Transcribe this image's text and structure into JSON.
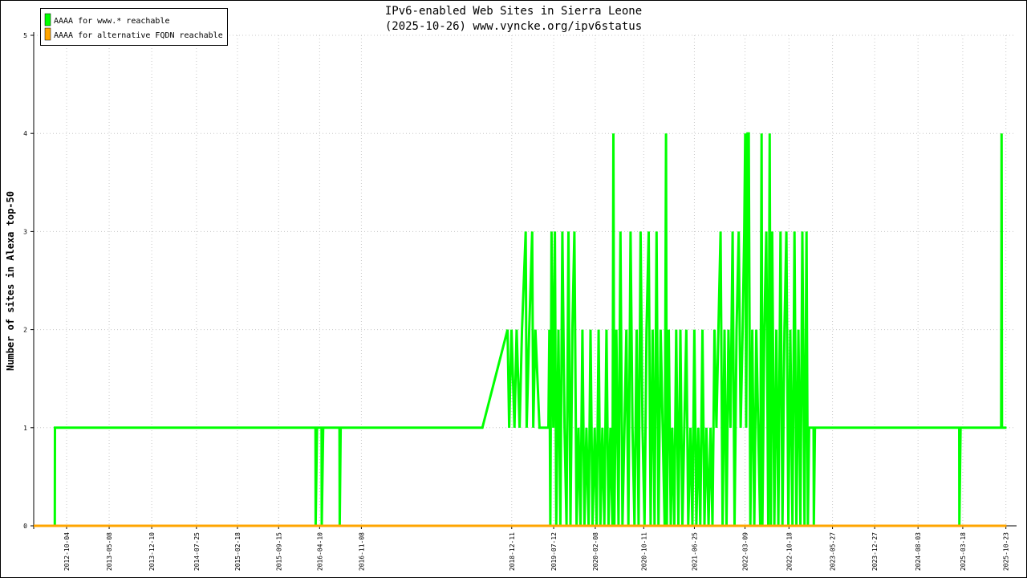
{
  "chart_data": {
    "type": "line",
    "title": "IPv6-enabled Web Sites in Sierra Leone",
    "subtitle": "(2025-10-26) www.vyncke.org/ipv6status",
    "ylabel": "Number of sites in Alexa top-50",
    "xlabel": "",
    "ylim": [
      0,
      5
    ],
    "yticks": [
      "0",
      "1",
      "2",
      "3",
      "4",
      "5"
    ],
    "xlim": [
      "2012-04-20",
      "2025-12-08"
    ],
    "xticks": [
      "2012-10-04",
      "2013-05-08",
      "2013-12-10",
      "2014-07-25",
      "2015-02-18",
      "2015-09-15",
      "2016-04-10",
      "2016-11-08",
      "2018-12-11",
      "2019-07-12",
      "2020-02-08",
      "2020-10-11",
      "2021-06-25",
      "2022-03-09",
      "2022-10-18",
      "2023-05-27",
      "2023-12-27",
      "2024-08-03",
      "2025-03-18",
      "2025-10-23"
    ],
    "grid": true,
    "legend_position": "top-left",
    "series": [
      {
        "name": "AAAA for www.* reachable",
        "color": "#00ff00",
        "points": [
          [
            "2012-04-20",
            0
          ],
          [
            "2012-08-05",
            0
          ],
          [
            "2012-08-06",
            1
          ],
          [
            "2016-03-20",
            1
          ],
          [
            "2016-03-21",
            0
          ],
          [
            "2016-03-28",
            1
          ],
          [
            "2016-04-20",
            1
          ],
          [
            "2016-04-21",
            0
          ],
          [
            "2016-04-28",
            1
          ],
          [
            "2016-07-20",
            1
          ],
          [
            "2016-07-21",
            0
          ],
          [
            "2016-07-26",
            1
          ],
          [
            "2018-07-15",
            1
          ],
          [
            "2018-11-20",
            2
          ],
          [
            "2018-11-28",
            1
          ],
          [
            "2018-12-10",
            2
          ],
          [
            "2018-12-25",
            1
          ],
          [
            "2019-01-05",
            2
          ],
          [
            "2019-01-20",
            1
          ],
          [
            "2019-02-01",
            2
          ],
          [
            "2019-02-20",
            3
          ],
          [
            "2019-02-25",
            1
          ],
          [
            "2019-03-10",
            2
          ],
          [
            "2019-03-25",
            3
          ],
          [
            "2019-03-30",
            1
          ],
          [
            "2019-04-10",
            2
          ],
          [
            "2019-05-01",
            1
          ],
          [
            "2019-06-15",
            1
          ],
          [
            "2019-06-20",
            2
          ],
          [
            "2019-06-25",
            0
          ],
          [
            "2019-07-01",
            3
          ],
          [
            "2019-07-10",
            1
          ],
          [
            "2019-07-18",
            3
          ],
          [
            "2019-07-25",
            0
          ],
          [
            "2019-08-05",
            2
          ],
          [
            "2019-08-15",
            0
          ],
          [
            "2019-08-25",
            3
          ],
          [
            "2019-09-05",
            1
          ],
          [
            "2019-09-15",
            0
          ],
          [
            "2019-09-25",
            3
          ],
          [
            "2019-10-05",
            0
          ],
          [
            "2019-10-15",
            2
          ],
          [
            "2019-10-25",
            3
          ],
          [
            "2019-11-05",
            0
          ],
          [
            "2019-11-15",
            1
          ],
          [
            "2019-11-25",
            0
          ],
          [
            "2019-12-05",
            2
          ],
          [
            "2019-12-15",
            0
          ],
          [
            "2019-12-25",
            1
          ],
          [
            "2020-01-05",
            0
          ],
          [
            "2020-01-15",
            2
          ],
          [
            "2020-01-25",
            0
          ],
          [
            "2020-02-05",
            1
          ],
          [
            "2020-02-15",
            0
          ],
          [
            "2020-02-25",
            2
          ],
          [
            "2020-03-05",
            0
          ],
          [
            "2020-03-15",
            1
          ],
          [
            "2020-03-25",
            0
          ],
          [
            "2020-04-05",
            2
          ],
          [
            "2020-04-15",
            0
          ],
          [
            "2020-04-25",
            1
          ],
          [
            "2020-05-05",
            0
          ],
          [
            "2020-05-10",
            4
          ],
          [
            "2020-05-15",
            0
          ],
          [
            "2020-05-25",
            2
          ],
          [
            "2020-06-05",
            0
          ],
          [
            "2020-06-15",
            3
          ],
          [
            "2020-06-25",
            0
          ],
          [
            "2020-07-05",
            1
          ],
          [
            "2020-07-15",
            2
          ],
          [
            "2020-07-25",
            0
          ],
          [
            "2020-08-05",
            3
          ],
          [
            "2020-08-15",
            1
          ],
          [
            "2020-08-25",
            0
          ],
          [
            "2020-09-05",
            2
          ],
          [
            "2020-09-15",
            0
          ],
          [
            "2020-09-25",
            3
          ],
          [
            "2020-10-05",
            1
          ],
          [
            "2020-10-15",
            0
          ],
          [
            "2020-10-25",
            2
          ],
          [
            "2020-11-05",
            3
          ],
          [
            "2020-11-15",
            0
          ],
          [
            "2020-11-25",
            2
          ],
          [
            "2020-12-05",
            0
          ],
          [
            "2020-12-15",
            3
          ],
          [
            "2020-12-25",
            0
          ],
          [
            "2021-01-05",
            2
          ],
          [
            "2021-01-15",
            1
          ],
          [
            "2021-01-25",
            0
          ],
          [
            "2021-02-01",
            4
          ],
          [
            "2021-02-05",
            0
          ],
          [
            "2021-02-15",
            2
          ],
          [
            "2021-02-25",
            0
          ],
          [
            "2021-03-05",
            1
          ],
          [
            "2021-03-15",
            0
          ],
          [
            "2021-03-25",
            2
          ],
          [
            "2021-04-05",
            0
          ],
          [
            "2021-04-15",
            2
          ],
          [
            "2021-04-25",
            0
          ],
          [
            "2021-05-05",
            1
          ],
          [
            "2021-05-15",
            2
          ],
          [
            "2021-05-25",
            0
          ],
          [
            "2021-06-05",
            1
          ],
          [
            "2021-06-15",
            0
          ],
          [
            "2021-06-25",
            2
          ],
          [
            "2021-07-05",
            0
          ],
          [
            "2021-07-15",
            1
          ],
          [
            "2021-07-25",
            0
          ],
          [
            "2021-08-05",
            2
          ],
          [
            "2021-08-15",
            0
          ],
          [
            "2021-08-25",
            1
          ],
          [
            "2021-09-05",
            0
          ],
          [
            "2021-09-15",
            1
          ],
          [
            "2021-09-25",
            0
          ],
          [
            "2021-10-05",
            2
          ],
          [
            "2021-10-15",
            1
          ],
          [
            "2021-10-25",
            2
          ],
          [
            "2021-11-05",
            3
          ],
          [
            "2021-11-15",
            0
          ],
          [
            "2021-11-25",
            2
          ],
          [
            "2021-12-05",
            0
          ],
          [
            "2021-12-15",
            2
          ],
          [
            "2021-12-25",
            1
          ],
          [
            "2022-01-05",
            3
          ],
          [
            "2022-01-15",
            0
          ],
          [
            "2022-01-25",
            2
          ],
          [
            "2022-02-05",
            3
          ],
          [
            "2022-02-15",
            1
          ],
          [
            "2022-02-25",
            2
          ],
          [
            "2022-03-05",
            3
          ],
          [
            "2022-03-10",
            4
          ],
          [
            "2022-03-15",
            1
          ],
          [
            "2022-03-22",
            4
          ],
          [
            "2022-03-28",
            4
          ],
          [
            "2022-04-05",
            0
          ],
          [
            "2022-04-15",
            2
          ],
          [
            "2022-04-25",
            0
          ],
          [
            "2022-05-05",
            2
          ],
          [
            "2022-05-15",
            1
          ],
          [
            "2022-05-25",
            0
          ],
          [
            "2022-06-01",
            4
          ],
          [
            "2022-06-05",
            0
          ],
          [
            "2022-06-15",
            2
          ],
          [
            "2022-06-25",
            3
          ],
          [
            "2022-07-05",
            0
          ],
          [
            "2022-07-12",
            4
          ],
          [
            "2022-07-18",
            0
          ],
          [
            "2022-07-25",
            3
          ],
          [
            "2022-08-05",
            0
          ],
          [
            "2022-08-15",
            2
          ],
          [
            "2022-08-25",
            0
          ],
          [
            "2022-09-05",
            3
          ],
          [
            "2022-09-15",
            0
          ],
          [
            "2022-09-25",
            2
          ],
          [
            "2022-10-05",
            3
          ],
          [
            "2022-10-15",
            0
          ],
          [
            "2022-10-25",
            2
          ],
          [
            "2022-11-05",
            0
          ],
          [
            "2022-11-15",
            3
          ],
          [
            "2022-11-25",
            0
          ],
          [
            "2022-12-05",
            2
          ],
          [
            "2022-12-15",
            0
          ],
          [
            "2022-12-25",
            3
          ],
          [
            "2023-01-05",
            0
          ],
          [
            "2023-01-15",
            3
          ],
          [
            "2023-01-22",
            0
          ],
          [
            "2023-01-28",
            1
          ],
          [
            "2023-02-20",
            1
          ],
          [
            "2023-02-21",
            0
          ],
          [
            "2023-02-27",
            1
          ],
          [
            "2025-02-28",
            1
          ],
          [
            "2025-03-01",
            0
          ],
          [
            "2025-03-07",
            1
          ],
          [
            "2025-09-29",
            1
          ],
          [
            "2025-09-30",
            2.5
          ],
          [
            "2025-10-01",
            4
          ],
          [
            "2025-10-03",
            1
          ],
          [
            "2025-10-26",
            1
          ]
        ]
      },
      {
        "name": "AAAA for alternative FQDN reachable",
        "color": "#ffa500",
        "points": [
          [
            "2012-04-20",
            0
          ],
          [
            "2025-10-26",
            0
          ]
        ]
      }
    ]
  }
}
